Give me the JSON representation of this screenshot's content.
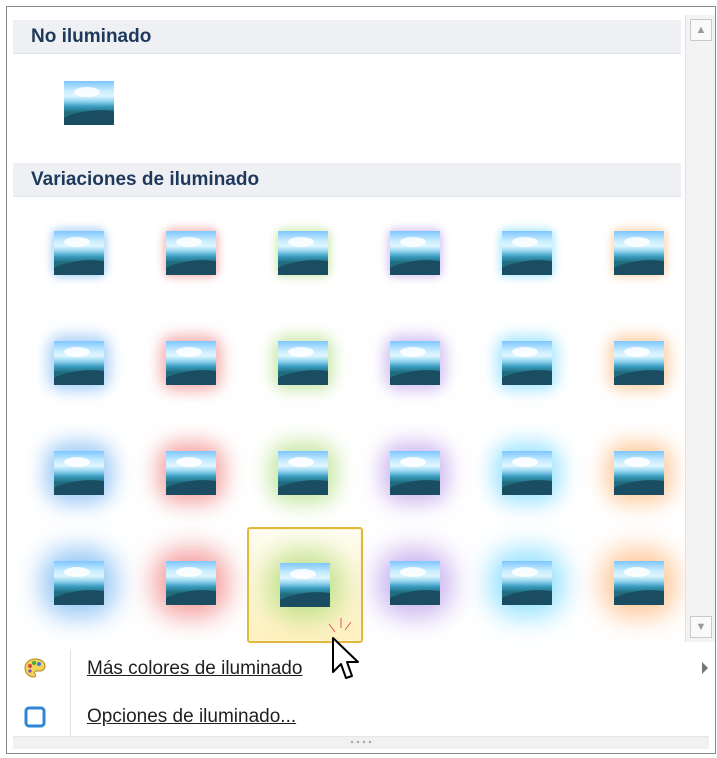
{
  "sections": {
    "no_glow": {
      "title": "No iluminado"
    },
    "variations": {
      "title": "Variaciones de iluminado"
    }
  },
  "gallery": {
    "glow_colors": [
      "#5fa9f1",
      "#ef6f6f",
      "#a4d86b",
      "#b08ee8",
      "#61d3ff",
      "#ffad66"
    ],
    "rows": 4,
    "columns": 6,
    "selected": {
      "row": 3,
      "column": 2
    }
  },
  "menu": {
    "more_colors_label": "Más colores de iluminado",
    "options_label": "Opciones de iluminado..."
  },
  "icons": {
    "more_colors": "palette-icon",
    "options": "glow-options-icon",
    "cursor": "mouse-pointer-icon"
  }
}
